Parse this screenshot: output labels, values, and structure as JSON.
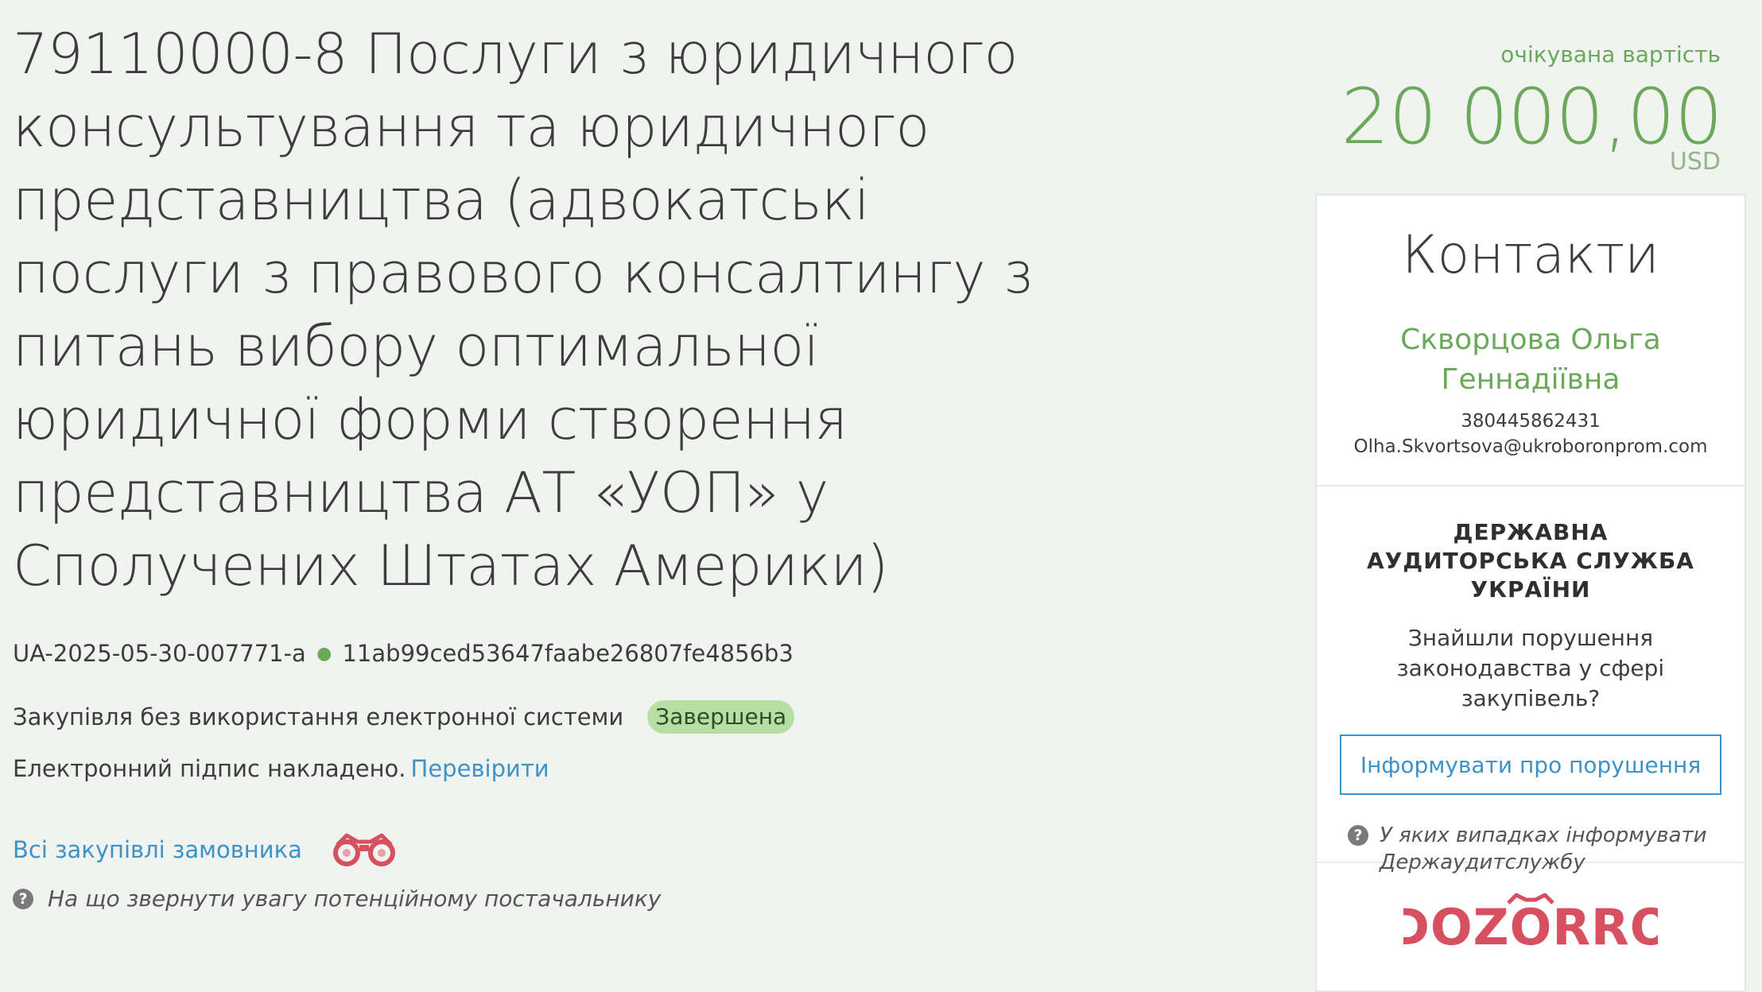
{
  "tender": {
    "title": "79110000-8 Послуги з юридичного консультування та юридичного представництва (адвокатські послуги з правового консалтингу з питань вибору оптимальної юридичної форми створення представництва АТ «УОП» у Сполучених Штатах Америки)",
    "id": "UA-2025-05-30-007771-a",
    "hash": "11ab99ced53647faabe26807fe4856b3",
    "procurement_type": "Закупівля без використання електронної системи",
    "status": "Завершена",
    "signature_text": "Електронний підпис накладено.",
    "signature_check_link": "Перевірити",
    "all_purchases_link": "Всі закупівлі замовника",
    "supplier_hint": "На що звернути увагу потенційному постачальнику"
  },
  "value": {
    "label": "очікувана вартість",
    "amount": "20 000,00",
    "currency": "USD"
  },
  "contacts": {
    "heading": "Контакти",
    "name": "Скворцова Ольга Геннадіївна",
    "phone": "380445862431",
    "email": "Olha.Skvortsova@ukroboronprom.com"
  },
  "audit": {
    "title": "ДЕРЖАВНА АУДИТОРСЬКА СЛУЖБА УКРАЇНИ",
    "question": "Знайшли порушення законодавства у сфері закупівель?",
    "report_button": "Інформувати про порушення",
    "hint": "У яких випадках інформувати Держаудитслужбу"
  },
  "dozorro": {
    "logo_text": "DOZORRO",
    "color": "#d6505f"
  },
  "icons": {
    "binoculars": "binoculars-icon",
    "question": "question-circle-icon"
  }
}
